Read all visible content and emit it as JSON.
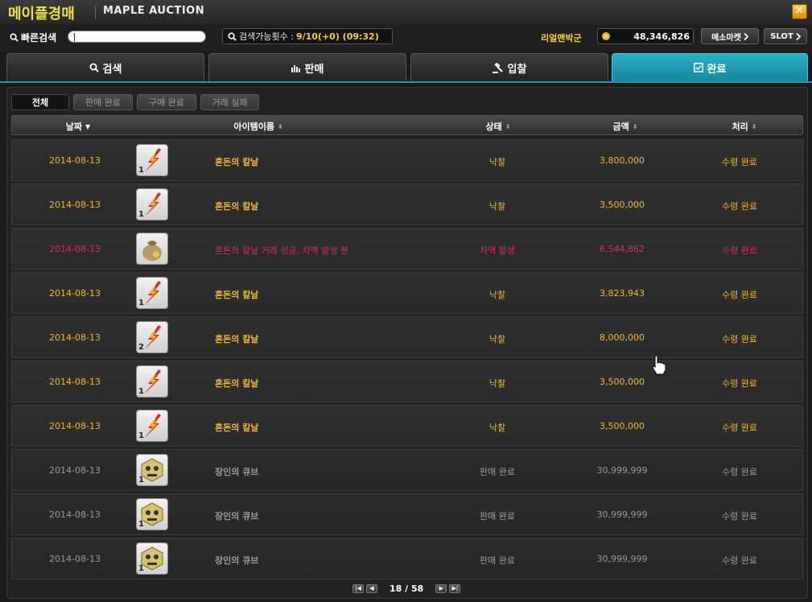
{
  "window": {
    "title_kr": "메이플경매",
    "title_en": "MAPLE AUCTION",
    "close_glyph": "✕"
  },
  "toolbar": {
    "quick_search_label": "빠른검색",
    "quick_search_value": "|",
    "search_count_label": "검색가능횟수 :",
    "search_count_value": "9/10(+0) (09:32)",
    "user_name": "리얼맨박군",
    "meso": "48,346,826",
    "meso_market_label": "메소마켓",
    "slot_label": "SLOT"
  },
  "tabs": [
    {
      "label": "검색",
      "icon": "search-icon",
      "active": false
    },
    {
      "label": "판매",
      "icon": "bar-chart-icon",
      "active": false
    },
    {
      "label": "입찰",
      "icon": "gavel-icon",
      "active": false
    },
    {
      "label": "완료",
      "icon": "checkbox-icon",
      "active": true
    }
  ],
  "subtabs": [
    {
      "label": "전체",
      "active": true
    },
    {
      "label": "판매 완료",
      "active": false
    },
    {
      "label": "구매 완료",
      "active": false
    },
    {
      "label": "거래 실패",
      "active": false
    }
  ],
  "columns": {
    "date": "날짜",
    "item_name": "아이템이름",
    "status": "상태",
    "amount": "금액",
    "process": "처리"
  },
  "rows": [
    {
      "date": "2014-08-13",
      "icon": "red-flame-dagger-icon",
      "qty": "1",
      "name": "혼돈의 칼날",
      "status": "낙찰",
      "amount": "3,800,000",
      "process": "수령 완료",
      "style": "gold"
    },
    {
      "date": "2014-08-13",
      "icon": "red-flame-dagger-icon",
      "qty": "1",
      "name": "혼돈의 칼날",
      "status": "낙찰",
      "amount": "3,500,000",
      "process": "수령 완료",
      "style": "gold"
    },
    {
      "date": "2014-08-13",
      "icon": "meso-bag-icon",
      "qty": "",
      "name": "혼돈의 칼날  거래 성공, 차액 발생 분",
      "status": "차액 발생",
      "amount": "6,544,862",
      "process": "수령 완료",
      "style": "pink"
    },
    {
      "date": "2014-08-13",
      "icon": "red-flame-dagger-icon",
      "qty": "1",
      "name": "혼돈의 칼날",
      "status": "낙찰",
      "amount": "3,823,943",
      "process": "수령 완료",
      "style": "gold"
    },
    {
      "date": "2014-08-13",
      "icon": "red-flame-dagger-icon",
      "qty": "2",
      "name": "혼돈의 칼날",
      "status": "낙찰",
      "amount": "8,000,000",
      "process": "수령 완료",
      "style": "gold"
    },
    {
      "date": "2014-08-13",
      "icon": "red-flame-dagger-icon",
      "qty": "1",
      "name": "혼돈의 칼날",
      "status": "낙찰",
      "amount": "3,500,000",
      "process": "수령 완료",
      "style": "gold"
    },
    {
      "date": "2014-08-13",
      "icon": "red-flame-dagger-icon",
      "qty": "1",
      "name": "혼돈의 칼날",
      "status": "낙찰",
      "amount": "3,500,000",
      "process": "수령 완료",
      "style": "gold"
    },
    {
      "date": "2014-08-13",
      "icon": "craftsman-cube-icon",
      "qty": "1",
      "name": "장인의 큐브",
      "status": "판매 완료",
      "amount": "30,999,999",
      "process": "수령 완료",
      "style": "grey"
    },
    {
      "date": "2014-08-13",
      "icon": "craftsman-cube-icon",
      "qty": "1",
      "name": "장인의 큐브",
      "status": "판매 완료",
      "amount": "30,999,999",
      "process": "수령 완료",
      "style": "grey"
    },
    {
      "date": "2014-08-13",
      "icon": "craftsman-cube-icon",
      "qty": "1",
      "name": "장인의 큐브",
      "status": "판매 완료",
      "amount": "30,999,999",
      "process": "수령 완료",
      "style": "grey"
    }
  ],
  "pager": {
    "current": "18",
    "separator": " / ",
    "total": "58",
    "first": "|◀",
    "prev": "◀",
    "next": "▶",
    "last": "▶|"
  },
  "colors": {
    "accent": "#1a9cb2",
    "gold": "#f5b820",
    "pink": "#d82a6a",
    "grey": "#9c9c9c"
  }
}
